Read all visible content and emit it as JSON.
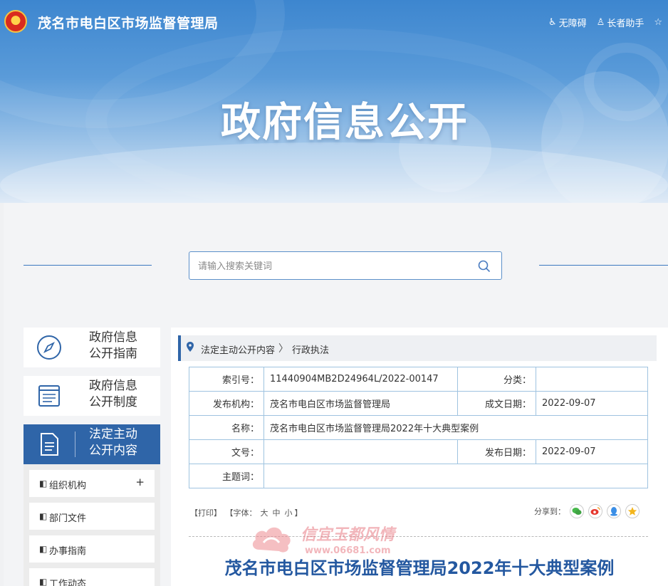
{
  "header": {
    "site_title": "茂名市电白区市场监督管理局",
    "accessibility": "无障碍",
    "elder_mode": "长者助手",
    "banner_title": "政府信息公开"
  },
  "search": {
    "placeholder": "请输入搜索关键词"
  },
  "sidebar": {
    "items": [
      {
        "label_line1": "政府信息",
        "label_line2": "公开指南"
      },
      {
        "label_line1": "政府信息",
        "label_line2": "公开制度"
      },
      {
        "label_line1": "法定主动",
        "label_line2": "公开内容"
      }
    ],
    "subitems": [
      {
        "label": "组织机构",
        "expand": "+"
      },
      {
        "label": "部门文件"
      },
      {
        "label": "办事指南"
      },
      {
        "label": "工作动态"
      }
    ]
  },
  "breadcrumb": {
    "level1": "法定主动公开内容",
    "separator": "〉",
    "level2": "行政执法"
  },
  "meta": {
    "index_label": "索引号：",
    "index_value": "11440904MB2D24964L/2022-00147",
    "category_label": "分类：",
    "category_value": "",
    "publisher_label": "发布机构：",
    "publisher_value": "茂名市电白区市场监督管理局",
    "created_label": "成文日期：",
    "created_value": "2022-09-07",
    "name_label": "名称：",
    "name_value": "茂名市电白区市场监督管理局2022年十大典型案例",
    "docno_label": "文号：",
    "docno_value": "",
    "published_label": "发布日期：",
    "published_value": "2022-09-07",
    "subject_label": "主题词：",
    "subject_value": ""
  },
  "tools": {
    "print": "【打印】",
    "font_prefix": "【字体：",
    "font_large": "大",
    "font_medium": "中",
    "font_small": "小",
    "font_suffix": "】",
    "share_label": "分享到："
  },
  "article": {
    "title": "茂名市电白区市场监督管理局2022年十大典型案例"
  },
  "watermark": {
    "text": "信宜玉都风情",
    "url": "www.06681.com"
  },
  "colors": {
    "primary": "#2f65a8",
    "title": "#2458a0",
    "border": "#9fc3e0"
  }
}
